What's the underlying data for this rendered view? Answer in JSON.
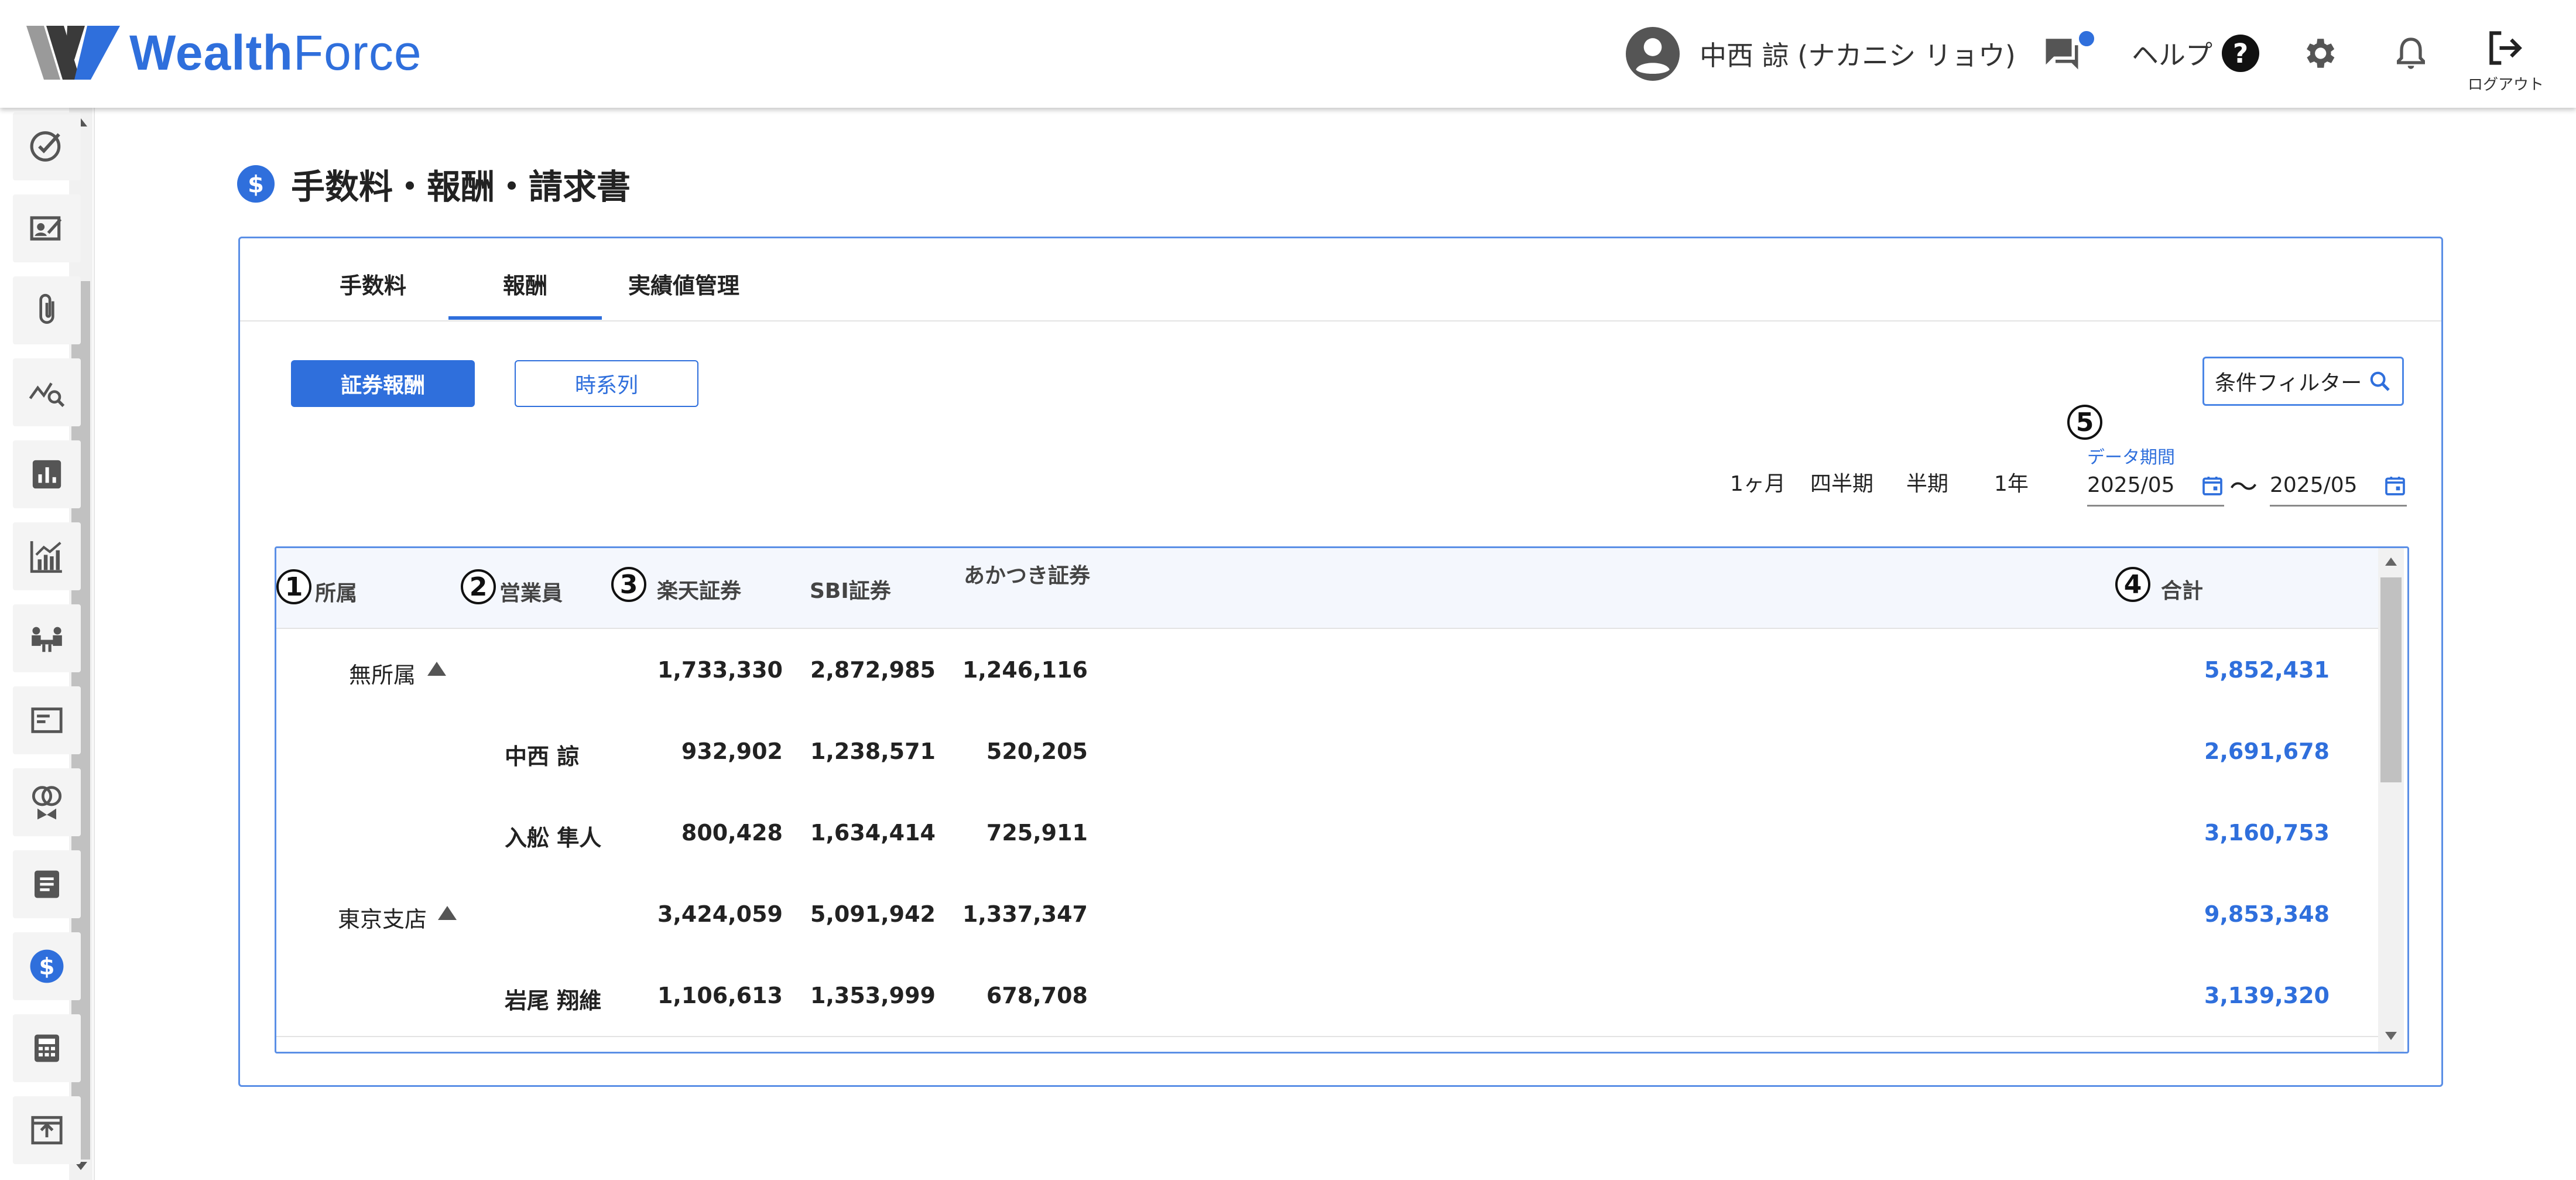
{
  "app": {
    "logo_bold": "Wealth",
    "logo_light": "Force"
  },
  "header": {
    "user_name": "中西 諒 (ナカニシ リョウ)",
    "help_label": "ヘルプ",
    "logout_label": "ログアウト"
  },
  "sidebar": {
    "icons": [
      "check-circle-icon",
      "id-card-icon",
      "paperclip-icon",
      "chart-search-icon",
      "bar-chart-icon",
      "growth-chart-icon",
      "meeting-icon",
      "card-icon",
      "rings-icon",
      "document-icon",
      "dollar-icon",
      "calculator-icon",
      "upload-icon"
    ],
    "active_index": 10
  },
  "page": {
    "title": "手数料・報酬・請求書"
  },
  "tabs": [
    {
      "label": "手数料"
    },
    {
      "label": "報酬"
    },
    {
      "label": "実績値管理"
    }
  ],
  "buttons": {
    "primary": "証券報酬",
    "secondary": "時系列"
  },
  "filter": {
    "label": "条件フィルター"
  },
  "periods": [
    "1ヶ月",
    "四半期",
    "半期",
    "1年"
  ],
  "markers": [
    "1",
    "2",
    "3",
    "4",
    "5"
  ],
  "date_range": {
    "label": "データ期間",
    "from": "2025/05",
    "to": "2025/05",
    "separator": "〜"
  },
  "table": {
    "headers": {
      "affiliation": "所属",
      "salesperson": "営業員",
      "rakuten": "楽天証券",
      "sbi": "SBI証券",
      "akatsuki": "あかつき証券",
      "total": "合計"
    },
    "rows": [
      {
        "affiliation": "無所属",
        "salesperson": "",
        "rakuten": "1,733,330",
        "sbi": "2,872,985",
        "akatsuki": "1,246,116",
        "total": "5,852,431",
        "group": true
      },
      {
        "affiliation": "",
        "salesperson": "中西 諒",
        "rakuten": "932,902",
        "sbi": "1,238,571",
        "akatsuki": "520,205",
        "total": "2,691,678",
        "group": false
      },
      {
        "affiliation": "",
        "salesperson": "入舩 隼人",
        "rakuten": "800,428",
        "sbi": "1,634,414",
        "akatsuki": "725,911",
        "total": "3,160,753",
        "group": false
      },
      {
        "affiliation": "東京支店",
        "salesperson": "",
        "rakuten": "3,424,059",
        "sbi": "5,091,942",
        "akatsuki": "1,337,347",
        "total": "9,853,348",
        "group": true
      },
      {
        "affiliation": "",
        "salesperson": "岩尾 翔維",
        "rakuten": "1,106,613",
        "sbi": "1,353,999",
        "akatsuki": "678,708",
        "total": "3,139,320",
        "group": false
      }
    ]
  },
  "colors": {
    "accent": "#2f6fdc",
    "border": "#5b8fe6"
  }
}
